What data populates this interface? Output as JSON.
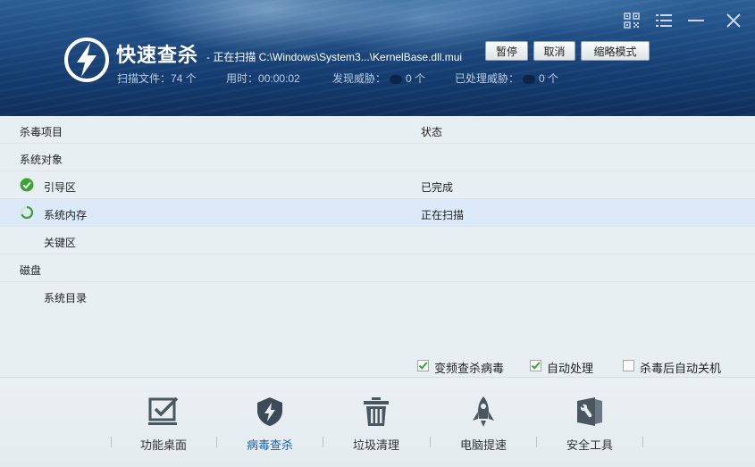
{
  "header": {
    "title": "快速查杀",
    "scan_status": "- 正在扫描 C:\\Windows\\System3...\\KernelBase.dll.mui",
    "stats": {
      "files_label": "扫描文件：",
      "files_value": "74 个",
      "time_label": "用时：",
      "time_value": "00:00:02",
      "threats_label": "发现威胁：",
      "threats_value": "0 个",
      "handled_label": "已处理威胁：",
      "handled_value": "0 个"
    },
    "buttons": {
      "pause": "暂停",
      "cancel": "取消",
      "compact": "缩略模式"
    },
    "window_icons": [
      "qr-code-icon",
      "menu-icon",
      "minimize-icon",
      "close-icon"
    ]
  },
  "list": {
    "col_item": "杀毒项目",
    "col_status": "状态",
    "rows": [
      {
        "label": "系统对象",
        "status": "",
        "type": "group"
      },
      {
        "label": "引导区",
        "status": "已完成",
        "type": "item",
        "icon": "check-icon"
      },
      {
        "label": "系统内存",
        "status": "正在扫描",
        "type": "item",
        "icon": "spinner-icon",
        "highlighted": true
      },
      {
        "label": "关键区",
        "status": "",
        "type": "item"
      },
      {
        "label": "磁盘",
        "status": "",
        "type": "group"
      },
      {
        "label": "系统目录",
        "status": "",
        "type": "item"
      }
    ]
  },
  "options": [
    {
      "label": "变频查杀病毒",
      "checked": true
    },
    {
      "label": "自动处理",
      "checked": true
    },
    {
      "label": "杀毒后自动关机",
      "checked": false
    }
  ],
  "nav": [
    {
      "label": "功能桌面",
      "icon": "desktop-check-icon",
      "active": false
    },
    {
      "label": "病毒查杀",
      "icon": "shield-bolt-icon",
      "active": true
    },
    {
      "label": "垃圾清理",
      "icon": "trash-icon",
      "active": false
    },
    {
      "label": "电脑提速",
      "icon": "rocket-icon",
      "active": false
    },
    {
      "label": "安全工具",
      "icon": "toolbox-icon",
      "active": false
    }
  ],
  "colors": {
    "accent": "#1a5fa8",
    "check": "#3aa334",
    "header_bg": "#1d4b82"
  }
}
